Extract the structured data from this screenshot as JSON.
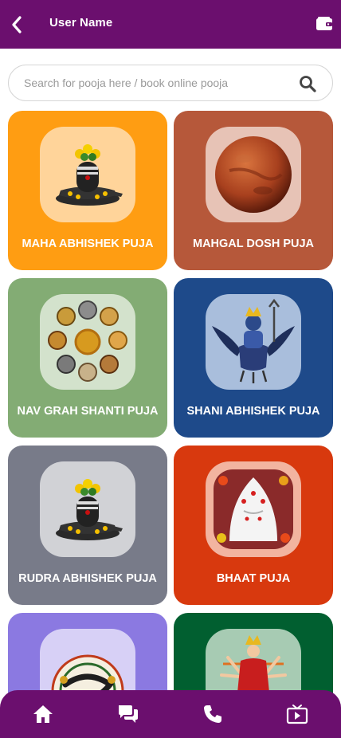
{
  "header": {
    "title": "User Name",
    "back_icon": "chevron-left-icon",
    "wallet_icon": "wallet-icon",
    "background": "#6b0f6e"
  },
  "search": {
    "placeholder": "Search for pooja here / book online pooja",
    "value": "",
    "icon": "search-icon"
  },
  "poojas": [
    {
      "label": "MAHA ABHISHEK PUJA",
      "color": "#ff9d12",
      "tile_color": "#ffd49a",
      "image": "shivling"
    },
    {
      "label": "MAHGAL DOSH PUJA",
      "color": "#b6583a",
      "tile_color": "#e7c3b6",
      "image": "mars-planet"
    },
    {
      "label": "NAV GRAH SHANTI PUJA",
      "color": "#83ac74",
      "tile_color": "#d3e2cc",
      "image": "navgrah-faces"
    },
    {
      "label": "SHANI ABHISHEK PUJA",
      "color": "#1e4a8a",
      "tile_color": "#a9bedc",
      "image": "shani-dev"
    },
    {
      "label": "RUDRA ABHISHEK PUJA",
      "color": "#787b89",
      "tile_color": "#d1d2d6",
      "image": "shivling"
    },
    {
      "label": "BHAAT PUJA",
      "color": "#d8390e",
      "tile_color": "#f2b4a0",
      "image": "bhaat-deity"
    },
    {
      "label": "",
      "color": "#8b79e1",
      "tile_color": "#d7d0f6",
      "image": "rahu-ketu-yantra"
    },
    {
      "label": "",
      "color": "#015f30",
      "tile_color": "#a7cbb3",
      "image": "durga-mata"
    }
  ],
  "bottom_nav": [
    {
      "name": "home",
      "icon": "home-icon"
    },
    {
      "name": "chat",
      "icon": "chat-icon"
    },
    {
      "name": "call",
      "icon": "phone-icon"
    },
    {
      "name": "live",
      "icon": "tv-icon"
    }
  ]
}
